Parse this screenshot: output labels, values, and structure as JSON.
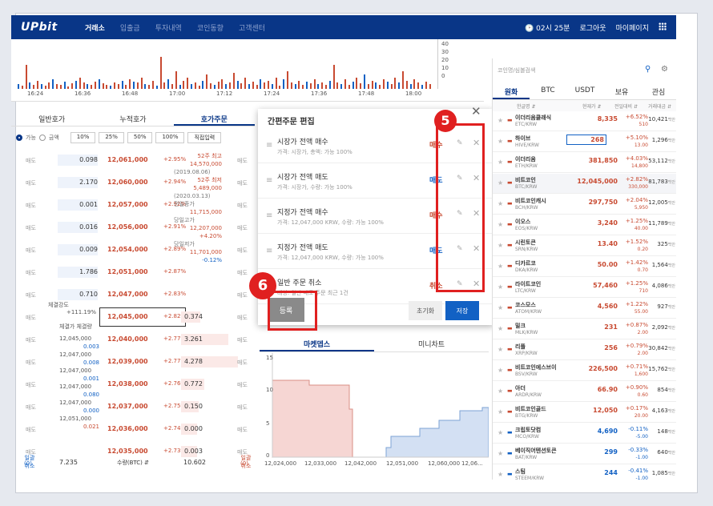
{
  "header": {
    "logo": "UPbit",
    "nav": [
      "거래소",
      "입출금",
      "투자내역",
      "코인동향",
      "고객센터"
    ],
    "time": "02시 25분",
    "logout": "로그아웃",
    "mypage": "마이페이지"
  },
  "chart": {
    "times": [
      "16:24",
      "16:36",
      "16:48",
      "17:00",
      "17:12",
      "17:24",
      "17:36",
      "17:48",
      "18:00"
    ],
    "yticks": [
      "40",
      "30",
      "20",
      "10",
      "0"
    ]
  },
  "orderbook": {
    "tabs": [
      "일반호가",
      "누적호가",
      "호가주문"
    ],
    "radio_on": "가능",
    "radio_off": "금액",
    "pct_buttons": [
      "10%",
      "25%",
      "50%",
      "100%",
      "직접입력"
    ],
    "rows": [
      {
        "side": "매도",
        "qty": "0.098",
        "price": "12,061,000",
        "pct": "+2.95%"
      },
      {
        "side": "매도",
        "qty": "2.170",
        "price": "12,060,000",
        "pct": "+2.94%"
      },
      {
        "side": "매도",
        "qty": "0.001",
        "price": "12,057,000",
        "pct": "+2.92%"
      },
      {
        "side": "매도",
        "qty": "0.016",
        "price": "12,056,000",
        "pct": "+2.91%"
      },
      {
        "side": "매도",
        "qty": "0.009",
        "price": "12,054,000",
        "pct": "+2.89%"
      },
      {
        "side": "매도",
        "qty": "1.786",
        "price": "12,051,000",
        "pct": "+2.87%"
      },
      {
        "side": "매도",
        "qty": "0.710",
        "price": "12,047,000",
        "pct": "+2.83%"
      },
      {
        "side": "매도",
        "qty": "",
        "price": "12,045,000",
        "pct": "+2.82%",
        "bid": "0.374"
      },
      {
        "side": "매도",
        "qty": "",
        "price": "12,040,000",
        "pct": "+2.77%",
        "bid": "3.261"
      },
      {
        "side": "매도",
        "qty": "",
        "price": "12,039,000",
        "pct": "+2.77%",
        "bid": "4.278"
      },
      {
        "side": "매도",
        "qty": "",
        "price": "12,038,000",
        "pct": "+2.76%",
        "bid": "0.772"
      },
      {
        "side": "매도",
        "qty": "",
        "price": "12,037,000",
        "pct": "+2.75%",
        "bid": "0.150"
      },
      {
        "side": "매도",
        "qty": "",
        "price": "12,036,000",
        "pct": "+2.74%",
        "bid": "0.000"
      },
      {
        "side": "매도",
        "qty": "",
        "price": "12,035,000",
        "pct": "+2.73%",
        "bid": "0.003"
      }
    ],
    "info": [
      "52주 최고",
      "14,570,000",
      "(2019.08.06)",
      "52주 최저",
      "5,489,000",
      "(2020.03.13)",
      "전일종가",
      "11,715,000",
      "당일고가",
      "12,207,000",
      "+4.20%",
      "당일저가",
      "11,701,000",
      "-0.12%"
    ],
    "strength_label": "체결강도",
    "strength": "+111.19%",
    "trade_cols": [
      "체결가",
      "체결량"
    ],
    "trades": [
      "12,045,000",
      "0.003",
      "12,047,000",
      "0.008",
      "12,047,000",
      "0.001",
      "12,047,000",
      "0.080",
      "12,047,000",
      "0.000",
      "12,051,000",
      "0.021"
    ],
    "foot": {
      "sell_total": "일괄 취소",
      "sell_total2": "(0)",
      "sell_qty": "7.235",
      "qty_label": "수량(BTC) ⇵",
      "buy_qty": "10.602",
      "buy_total": "일괄 취소",
      "buy_total2": "(0)"
    }
  },
  "quick": {
    "title": "간편주문 편집",
    "items": [
      {
        "t1": "시장가 전액 매수",
        "t2": "가격: 시장가, 총액: 가능 100%",
        "badge": "매수",
        "color": "up"
      },
      {
        "t1": "시장가 전액 매도",
        "t2": "가격: 시장가, 수량: 가능 100%",
        "badge": "매도",
        "color": "dn"
      },
      {
        "t1": "지정가 전액 매수",
        "t2": "가격: 12,047,000 KRW, 수량: 가능 100%",
        "badge": "매수",
        "color": "up"
      },
      {
        "t1": "지정가 전액 매도",
        "t2": "가격: 12,047,000 KRW, 수량: 가능 100%",
        "badge": "매도",
        "color": "dn"
      },
      {
        "t1": "일반 주문 취소",
        "t2": "대상: 일반 매도 주문 최근 1건",
        "badge": "취소",
        "color": "up"
      }
    ],
    "reset": "초기화",
    "ok": "저장",
    "register": "등록",
    "annot5": "5",
    "annot6": "6"
  },
  "depth": {
    "tabs": [
      "마켓뎁스",
      "미니차트"
    ],
    "yticks": [
      "15",
      "10",
      "5",
      "0"
    ],
    "xticks": [
      "12,024,000",
      "12,033,000",
      "12,042,000",
      "12,051,000",
      "12,060,000",
      "12,06..."
    ]
  },
  "market": {
    "search_placeholder": "코인명/심볼검색",
    "tabs": [
      "원화",
      "BTC",
      "USDT",
      "보유",
      "관심"
    ],
    "cols": [
      "한글명 ⇵",
      "현재가 ⇵",
      "전일대비 ⇵",
      "거래대금 ⇵"
    ],
    "coins": [
      {
        "name": "이더리움클래식",
        "tk": "ETC/KRW",
        "price": "8,335",
        "c1": "+6.52%",
        "c2": "510",
        "vol": "10,421",
        "dir": "up"
      },
      {
        "name": "하이브",
        "tk": "HIVE/KRW",
        "price": "268",
        "c1": "+5.10%",
        "c2": "13.00",
        "vol": "1,296",
        "dir": "up"
      },
      {
        "name": "이더리움",
        "tk": "ETH/KRW",
        "price": "381,850",
        "c1": "+4.03%",
        "c2": "14,800",
        "vol": "53,112",
        "dir": "up"
      },
      {
        "name": "비트코인",
        "tk": "BTC/KRW",
        "price": "12,045,000",
        "c1": "+2.82%",
        "c2": "330,000",
        "vol": "81,783",
        "dir": "up"
      },
      {
        "name": "비트코인캐시",
        "tk": "BCH/KRW",
        "price": "297,750",
        "c1": "+2.04%",
        "c2": "5,950",
        "vol": "12,005",
        "dir": "up"
      },
      {
        "name": "이오스",
        "tk": "EOS/KRW",
        "price": "3,240",
        "c1": "+1.25%",
        "c2": "40.00",
        "vol": "11,789",
        "dir": "up"
      },
      {
        "name": "시린토큰",
        "tk": "SRN/KRW",
        "price": "13.40",
        "c1": "+1.52%",
        "c2": "0.20",
        "vol": "325",
        "dir": "up"
      },
      {
        "name": "디카르코",
        "tk": "DKA/KRW",
        "price": "50.00",
        "c1": "+1.42%",
        "c2": "0.70",
        "vol": "1,564",
        "dir": "up"
      },
      {
        "name": "라이트코인",
        "tk": "LTC/KRW",
        "price": "57,460",
        "c1": "+1.25%",
        "c2": "710",
        "vol": "4,086",
        "dir": "up"
      },
      {
        "name": "코스모스",
        "tk": "ATOM/KRW",
        "price": "4,560",
        "c1": "+1.22%",
        "c2": "55.00",
        "vol": "927",
        "dir": "up"
      },
      {
        "name": "밀크",
        "tk": "MLK/KRW",
        "price": "231",
        "c1": "+0.87%",
        "c2": "2.00",
        "vol": "2,092",
        "dir": "up"
      },
      {
        "name": "리플",
        "tk": "XRP/KRW",
        "price": "256",
        "c1": "+0.79%",
        "c2": "2.00",
        "vol": "30,842",
        "dir": "up"
      },
      {
        "name": "비트코인에스브이",
        "tk": "BSV/KRW",
        "price": "226,500",
        "c1": "+0.71%",
        "c2": "1,600",
        "vol": "15,762",
        "dir": "up"
      },
      {
        "name": "아더",
        "tk": "ARDR/KRW",
        "price": "66.90",
        "c1": "+0.90%",
        "c2": "0.60",
        "vol": "854",
        "dir": "up"
      },
      {
        "name": "비트코인골드",
        "tk": "BTG/KRW",
        "price": "12,050",
        "c1": "+0.17%",
        "c2": "20.00",
        "vol": "4,163",
        "dir": "up"
      },
      {
        "name": "크립토닷컴",
        "tk": "MCO/KRW",
        "price": "4,690",
        "c1": "-0.11%",
        "c2": "-5.00",
        "vol": "148",
        "dir": "dn"
      },
      {
        "name": "베이직어텐션토큰",
        "tk": "BAT/KRW",
        "price": "299",
        "c1": "-0.33%",
        "c2": "-1.00",
        "vol": "640",
        "dir": "dn"
      },
      {
        "name": "스팀",
        "tk": "STEEM/KRW",
        "price": "244",
        "c1": "-0.41%",
        "c2": "-1.00",
        "vol": "1,085",
        "dir": "dn"
      }
    ],
    "vol_unit": "백만"
  }
}
